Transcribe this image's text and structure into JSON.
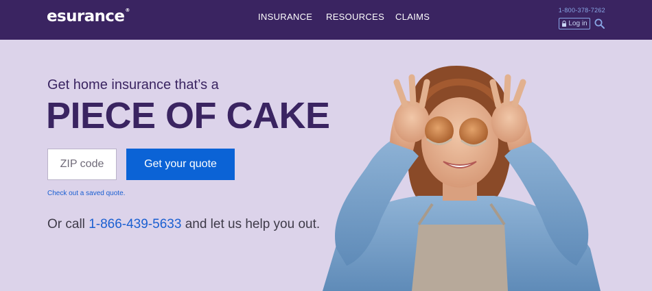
{
  "header": {
    "logo": "esurance",
    "logo_tm": "®",
    "nav": [
      "INSURANCE",
      "RESOURCES",
      "CLAIMS"
    ],
    "phone": "1-800-378-7262",
    "login_label": "Log in",
    "icons": {
      "login": "lock-icon",
      "search": "search-icon"
    }
  },
  "hero": {
    "subtitle": "Get home insurance that’s a",
    "title": "PIECE OF CAKE",
    "zip_placeholder": "ZIP code",
    "cta_label": "Get your quote",
    "saved_link": "Check out a saved quote.",
    "call_prefix": "Or call",
    "call_number": "1-866-439-5633",
    "call_suffix": "and let us help you out."
  },
  "colors": {
    "header_bg": "#3a2461",
    "hero_bg": "#dcd3ea",
    "title": "#3a2461",
    "cta_bg": "#0b63d6",
    "link": "#1a5fd1"
  }
}
